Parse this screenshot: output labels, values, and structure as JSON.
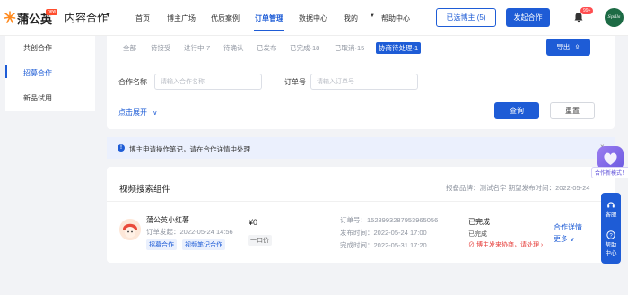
{
  "colors": {
    "accent": "#1e5cd6",
    "danger": "#e53935",
    "brand_orange": "#ff8a1f"
  },
  "topnav": {
    "logo_text": "蒲公英",
    "logo_badge": "new",
    "biz_switch": "内容合作",
    "items": [
      "首页",
      "博主广场",
      "优质案例",
      "订单管理",
      "数据中心",
      "我的",
      "帮助中心"
    ],
    "active_item": "订单管理",
    "selected_creators_label": "已选博主 (5)",
    "start_collab_label": "发起合作",
    "notification_count": "99+",
    "avatar_text": "Spills"
  },
  "sidebar": {
    "items": [
      {
        "label": "共创合作"
      },
      {
        "label": "招募合作",
        "active": true
      },
      {
        "label": "新品试用"
      }
    ]
  },
  "filter": {
    "status_tabs": [
      "全部",
      "待接受",
      "进行中·7",
      "待确认",
      "已发布",
      "已完成·18",
      "已取消·15",
      "协商待处理·1"
    ],
    "selected_tab": "协商待处理·1",
    "export_label": "导出",
    "collab_name_label": "合作名称",
    "collab_name_placeholder": "请输入合作名称",
    "order_no_label": "订单号",
    "order_no_placeholder": "请输入订单号",
    "expand_label": "点击展开",
    "query_label": "查询",
    "reset_label": "重置"
  },
  "notice": {
    "text": "博主申请操作笔记，请在合作详情中处理"
  },
  "order_card": {
    "title": "视频搜索组件",
    "meta": "报备品牌：测试名字   期望发布时间：2022-05-24",
    "creator_name": "蒲公英小红薯",
    "order_date": "订单发起：2022-05-24 14:56",
    "tags": [
      "招募合作",
      "视频笔记合作"
    ],
    "price": "¥0",
    "price_type": "一口价",
    "order_no_label": "订单号：",
    "order_no": "1528993287953965056",
    "publish_label": "发布时间：",
    "publish_time": "2022-05-24 17:00",
    "complete_label": "完成时间：",
    "complete_time": "2022-05-31 17:20",
    "status_main": "已完成",
    "status_sub": "已完成",
    "status_warning": "博主发来协商，请处理",
    "action_detail": "合作详情",
    "action_more": "更多"
  },
  "floating": {
    "new_badge": "合作新模式！",
    "service_label_1": "客服",
    "help_label_1": "帮助",
    "help_label_2": "中心"
  }
}
